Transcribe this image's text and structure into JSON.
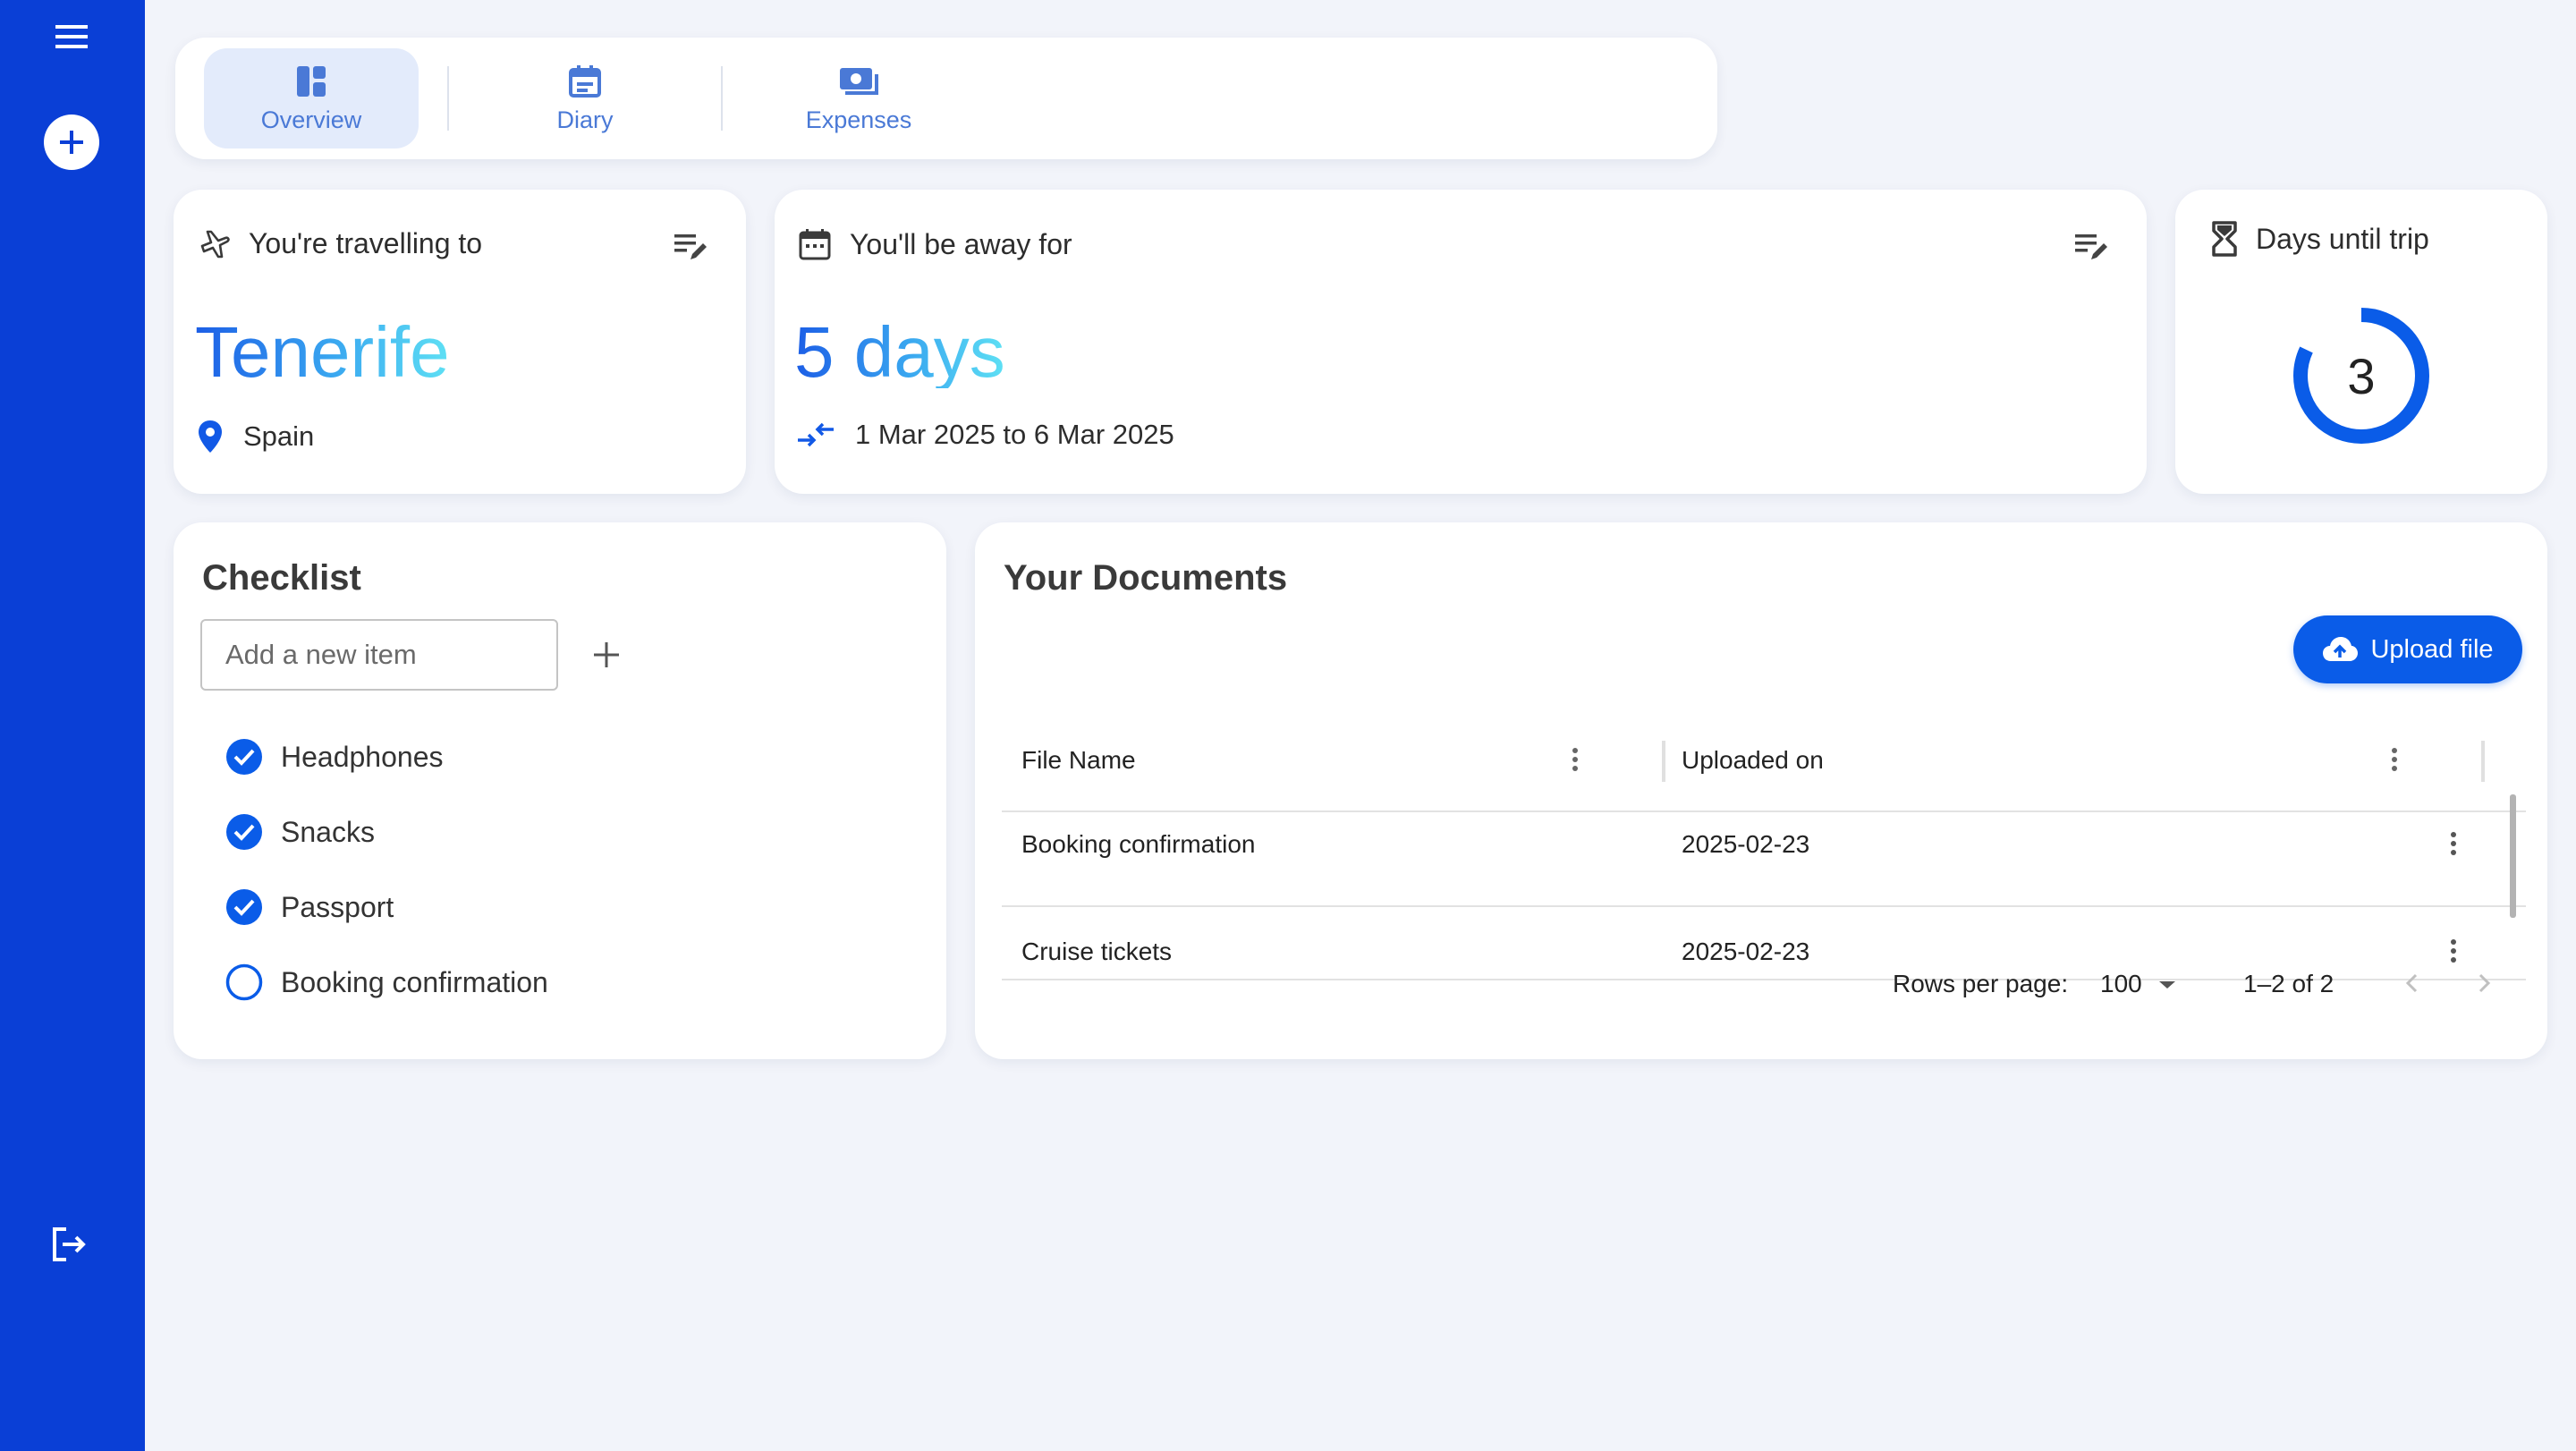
{
  "tabs": [
    {
      "label": "Overview",
      "icon": "dashboard-icon",
      "active": true
    },
    {
      "label": "Diary",
      "icon": "calendar-icon",
      "active": false
    },
    {
      "label": "Expenses",
      "icon": "money-icon",
      "active": false
    }
  ],
  "destination": {
    "header": "You're travelling to",
    "city": "Tenerife",
    "country": "Spain"
  },
  "duration": {
    "header": "You'll be away for",
    "value": "5 days",
    "range": "1 Mar 2025 to 6 Mar 2025"
  },
  "countdown": {
    "header": "Days until trip",
    "days": "3",
    "fraction": 0.82
  },
  "checklist": {
    "title": "Checklist",
    "placeholder": "Add a new item",
    "items": [
      {
        "label": "Headphones",
        "checked": true
      },
      {
        "label": "Snacks",
        "checked": true
      },
      {
        "label": "Passport",
        "checked": true
      },
      {
        "label": "Booking confirmation",
        "checked": false
      }
    ]
  },
  "documents": {
    "title": "Your Documents",
    "upload_label": "Upload file",
    "columns": [
      "File Name",
      "Uploaded on"
    ],
    "rows": [
      {
        "name": "Booking confirmation",
        "date": "2025-02-23"
      },
      {
        "name": "Cruise tickets",
        "date": "2025-02-23"
      }
    ],
    "rows_per_page_label": "Rows per page:",
    "rows_per_page": "100",
    "range_label": "1–2 of 2"
  },
  "colors": {
    "sidebar": "#0a3fd6",
    "accent": "#0a5ce8",
    "background": "#f2f4fa"
  }
}
